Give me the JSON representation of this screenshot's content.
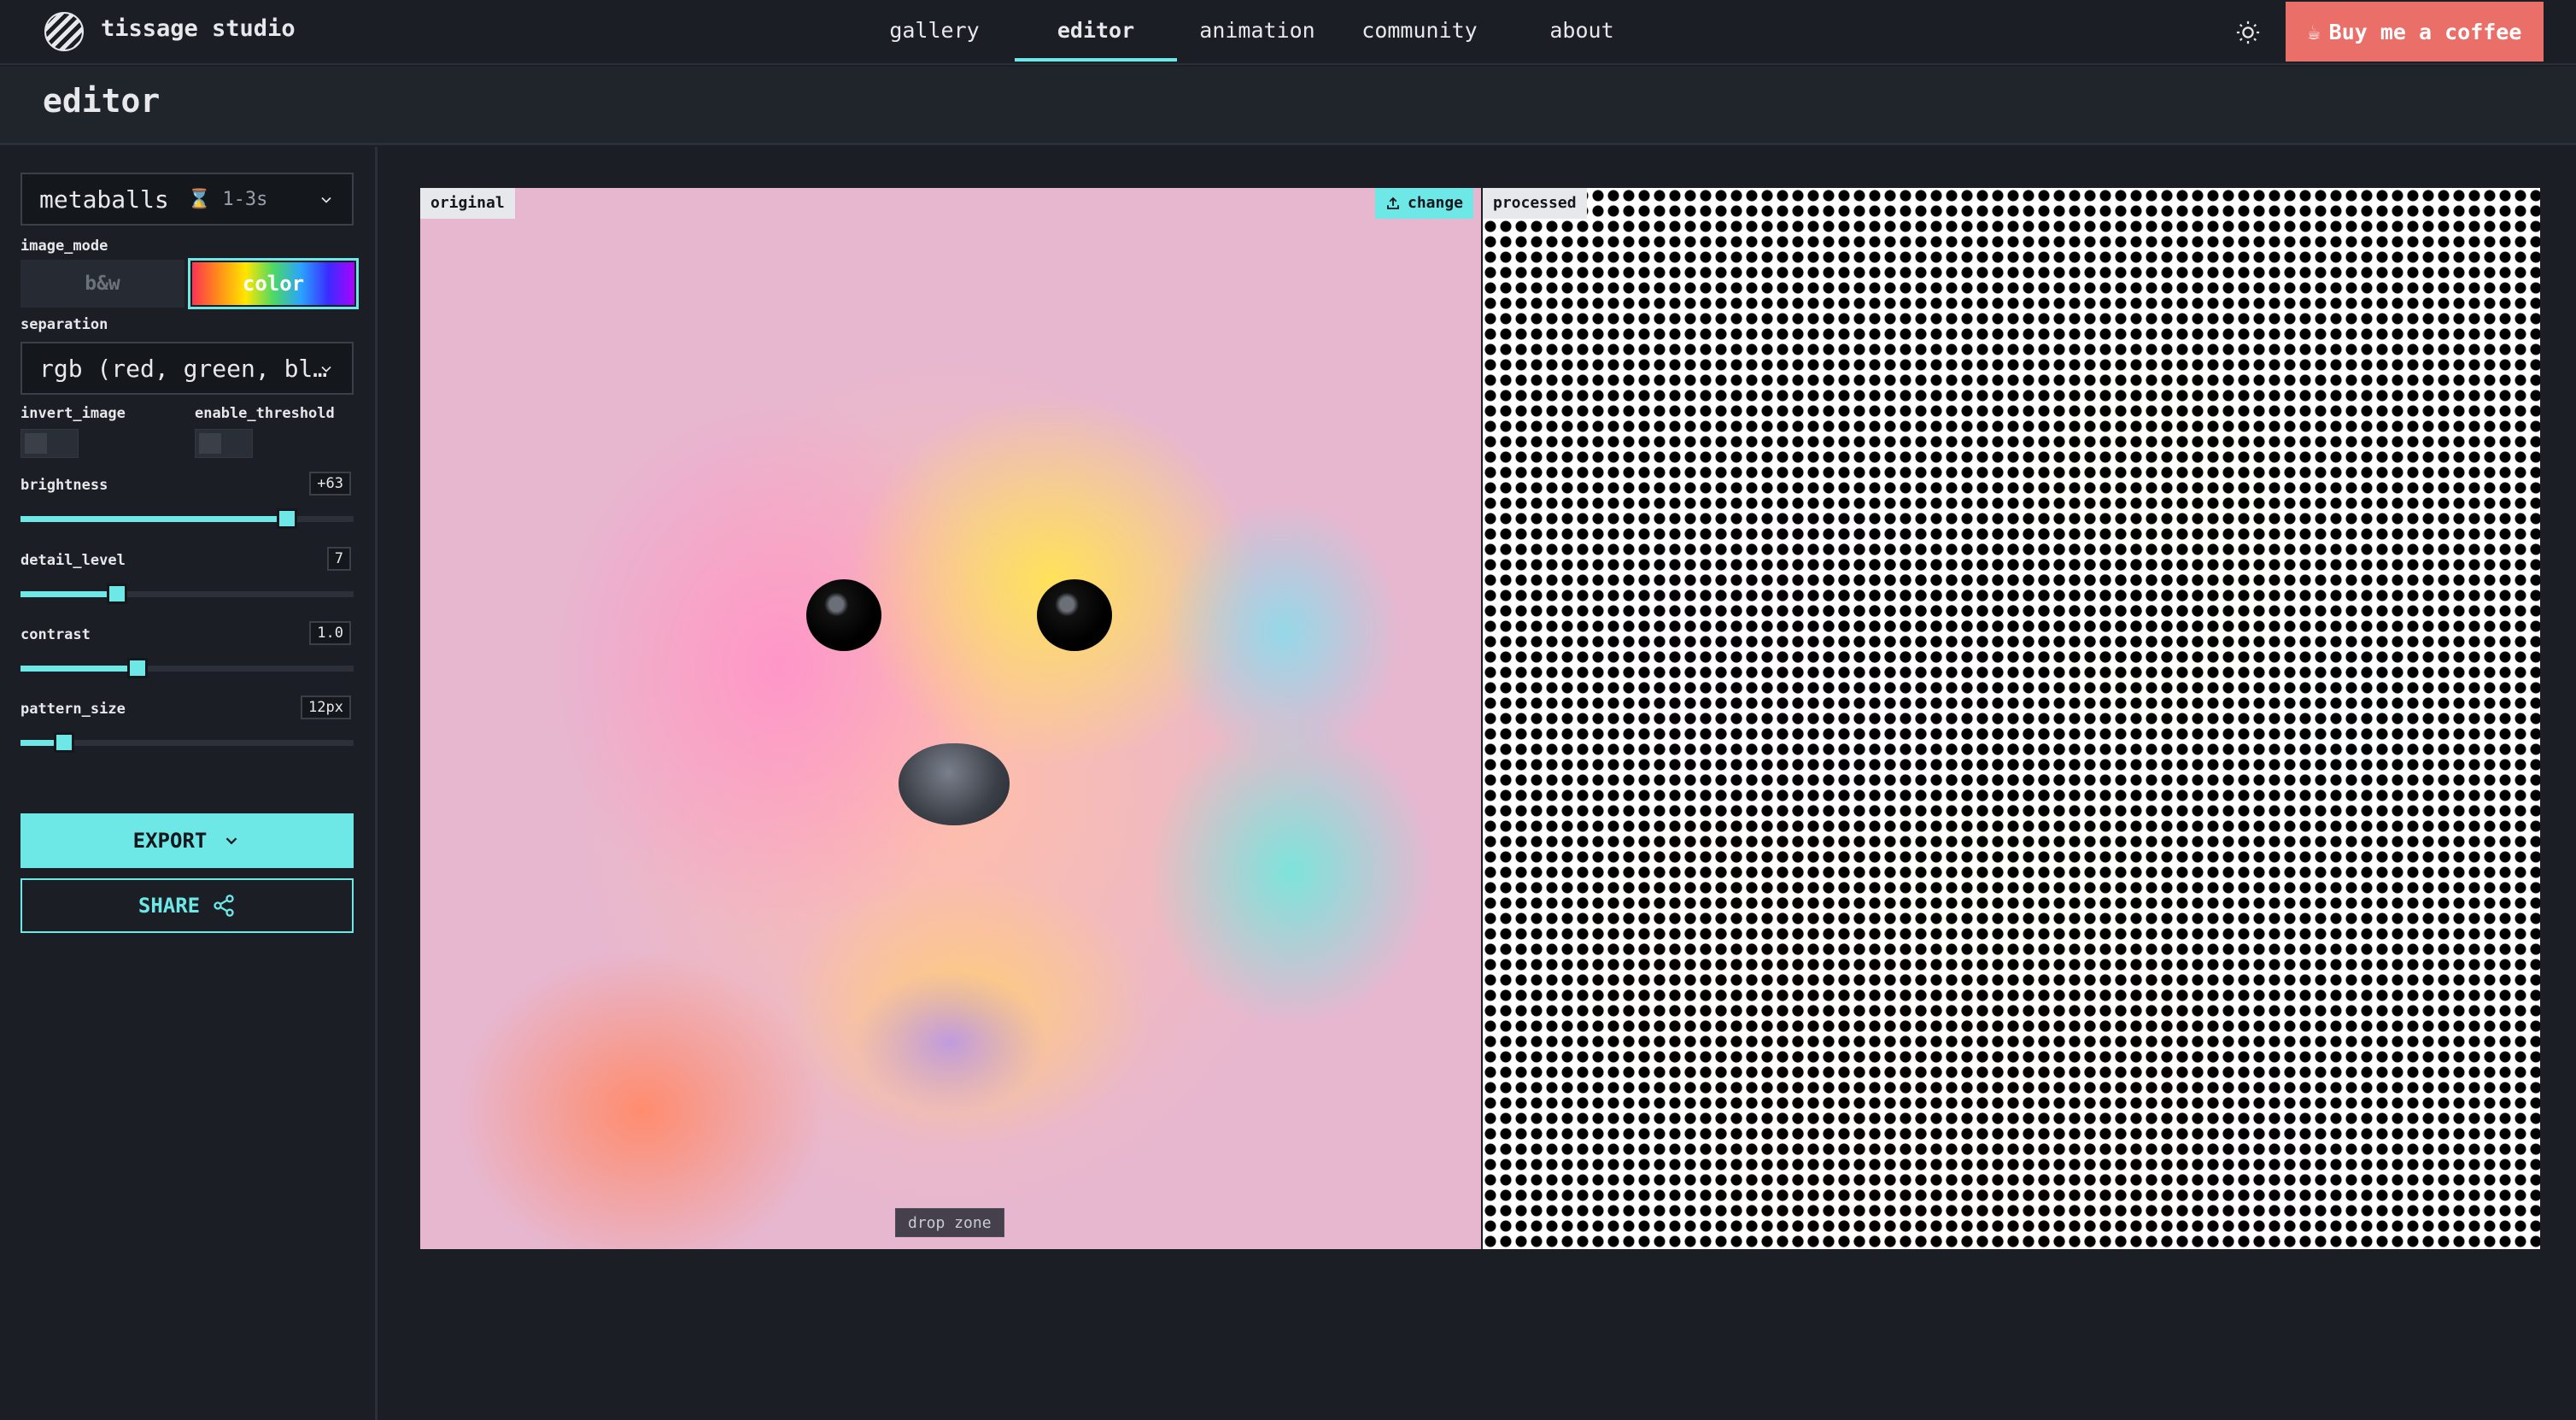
{
  "app": {
    "brand": "tissage studio"
  },
  "nav": {
    "items": [
      {
        "label": "gallery",
        "active": false
      },
      {
        "label": "editor",
        "active": true
      },
      {
        "label": "animation",
        "active": false
      },
      {
        "label": "community",
        "active": false
      },
      {
        "label": "about",
        "active": false
      }
    ],
    "coffee_label": "Buy me a coffee",
    "theme_icon": "sun-icon"
  },
  "page": {
    "title": "editor"
  },
  "sidebar": {
    "effect": {
      "value": "metaballs",
      "hint": "⌛ 1-3s"
    },
    "image_mode": {
      "label": "image_mode",
      "options": [
        "b&w",
        "color"
      ],
      "selected": "color"
    },
    "separation": {
      "label": "separation",
      "value": "rgb (red, green, bl…"
    },
    "invert_image": {
      "label": "invert_image",
      "on": false
    },
    "enable_threshold": {
      "label": "enable_threshold",
      "on": false
    },
    "sliders": [
      {
        "label": "brightness",
        "display": "+63",
        "fraction": 0.8
      },
      {
        "label": "detail_level",
        "display": "7",
        "fraction": 0.29
      },
      {
        "label": "contrast",
        "display": "1.0",
        "fraction": 0.35
      },
      {
        "label": "pattern_size",
        "display": "12px",
        "fraction": 0.13
      }
    ],
    "export_label": "EXPORT",
    "share_label": "SHARE"
  },
  "canvas": {
    "original_label": "original",
    "processed_label": "processed",
    "change_label": "change",
    "dropzone_label": "drop zone"
  },
  "colors": {
    "accent": "#6ee7e7",
    "coffee": "#ea6f68",
    "background": "#1b1e24"
  }
}
